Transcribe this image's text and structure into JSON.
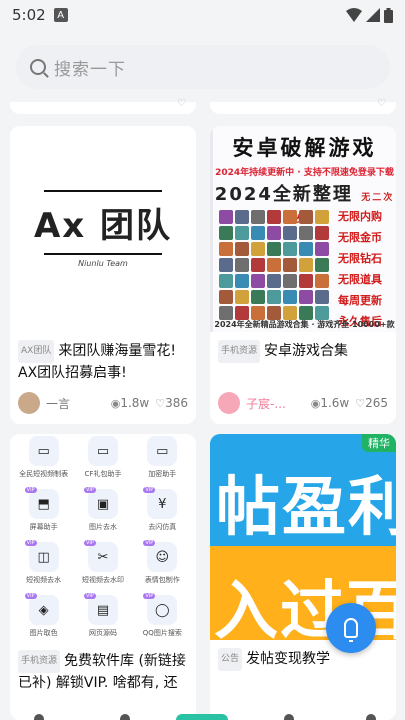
{
  "status_bar": {
    "time": "5:02",
    "notif": "A"
  },
  "search": {
    "placeholder": "搜索一下"
  },
  "cards": [
    {
      "thumb": {
        "title": "Ax 团队",
        "subtitle": "Niunlu Team"
      },
      "category": "AX团队",
      "title": "来团队赚海量雪花! AX团队招募启事!",
      "author": "一言",
      "views": "1.8w",
      "likes": "386"
    },
    {
      "thumb": {
        "title": "安卓破解游戏",
        "banner": "2024年持续更新中 · 支持不限速免登录下载",
        "big": "2024全新整理",
        "free": "无二次收费",
        "features": [
          "无限内购",
          "无限金币",
          "无限钻石",
          "无限道具",
          "每周更新",
          "永久售后"
        ],
        "footer": "2024年全新精品游戏合集 · 游戏齐全 10000+款"
      },
      "category": "手机资源",
      "title": "安卓游戏合集",
      "author": "子宸-...",
      "views": "1.6w",
      "likes": "265"
    },
    {
      "thumb": {
        "tools": [
          {
            "label": "全民短视频制表",
            "vip": false
          },
          {
            "label": "CF礼包助手",
            "vip": false
          },
          {
            "label": "加密助手",
            "vip": false
          },
          {
            "label": "屏幕助手",
            "vip": true
          },
          {
            "label": "图片去水",
            "vip": true
          },
          {
            "label": "去闪仿真",
            "vip": true
          },
          {
            "label": "短视频去水",
            "vip": true
          },
          {
            "label": "短视频去水印",
            "vip": true
          },
          {
            "label": "表情包制作",
            "vip": true
          },
          {
            "label": "图片取色",
            "vip": true
          },
          {
            "label": "网页源码",
            "vip": true
          },
          {
            "label": "QQ图片搜索",
            "vip": true
          }
        ]
      },
      "category": "手机资源",
      "title": "免费软件库 (新链接已补) 解锁VIP. 啥都有, 还能自行在",
      "author": "",
      "views": "",
      "likes": ""
    },
    {
      "thumb": {
        "badge": "精华",
        "text1": "帖盈利",
        "text2": "入过百"
      },
      "category": "公告",
      "title": "发帖变现教学",
      "author": "",
      "views": "",
      "likes": ""
    }
  ]
}
